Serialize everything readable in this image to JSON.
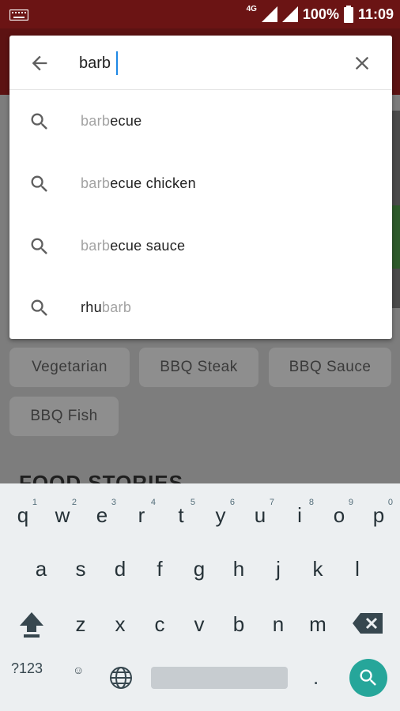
{
  "status_bar": {
    "network_type": "4G",
    "battery_percent": "100%",
    "time": "11:09",
    "icons": [
      "keyboard-icon",
      "signal-icon",
      "battery-icon"
    ]
  },
  "search": {
    "query": "barb",
    "icons": [
      "back-arrow-icon",
      "clear-icon"
    ],
    "suggestions": [
      {
        "match": "barb",
        "rest": "ecue",
        "prefix": ""
      },
      {
        "match": "barb",
        "rest": "ecue chicken",
        "prefix": ""
      },
      {
        "match": "barb",
        "rest": "ecue sauce",
        "prefix": ""
      },
      {
        "match": "barb",
        "rest": "",
        "prefix": "rhu"
      }
    ]
  },
  "background": {
    "chips": [
      "Vegetarian",
      "BBQ Steak",
      "BBQ Sauce",
      "BBQ Fish"
    ],
    "section_title": "FOOD STORIES"
  },
  "keyboard": {
    "row1": [
      "q",
      "w",
      "e",
      "r",
      "t",
      "y",
      "u",
      "i",
      "o",
      "p"
    ],
    "row1_hints": [
      "1",
      "2",
      "3",
      "4",
      "5",
      "6",
      "7",
      "8",
      "9",
      "0"
    ],
    "row2": [
      "a",
      "s",
      "d",
      "f",
      "g",
      "h",
      "j",
      "k",
      "l"
    ],
    "row3": [
      "z",
      "x",
      "c",
      "v",
      "b",
      "n",
      "m"
    ],
    "symbols_label": "?123",
    "period_label": ".",
    "emoji_label": "☺",
    "action_icon": "search-icon"
  },
  "colors": {
    "status_bar": "#6b1414",
    "caret": "#1e88e5",
    "keyboard_action": "#26a69a"
  }
}
